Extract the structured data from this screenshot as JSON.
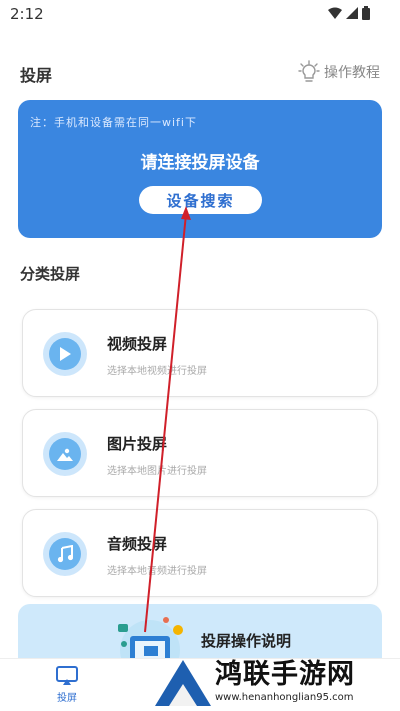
{
  "status_bar": {
    "time": "2:12"
  },
  "header": {
    "title": "投屏",
    "tutorial_label": "操作教程"
  },
  "blue_card": {
    "note": "注：手机和设备需在同一wifi下",
    "heading": "请连接投屏设备",
    "search_button": "设备搜索"
  },
  "categories": {
    "title": "分类投屏",
    "items": [
      {
        "name": "视频投屏",
        "desc": "选择本地视频进行投屏",
        "icon": "play-icon"
      },
      {
        "name": "图片投屏",
        "desc": "选择本地图片进行投屏",
        "icon": "image-icon"
      },
      {
        "name": "音频投屏",
        "desc": "选择本地音频进行投屏",
        "icon": "music-icon"
      }
    ]
  },
  "guide": {
    "label": "投屏操作说明"
  },
  "tabbar": {
    "tabs": [
      {
        "label": "投屏",
        "active": true
      }
    ]
  },
  "watermark": {
    "title": "鸿联手游网",
    "url": "www.henanhonglian95.com"
  },
  "colors": {
    "accent": "#3a86e0",
    "annotation_arrow": "#d0202a",
    "icon_circle": "#cde6fb"
  }
}
